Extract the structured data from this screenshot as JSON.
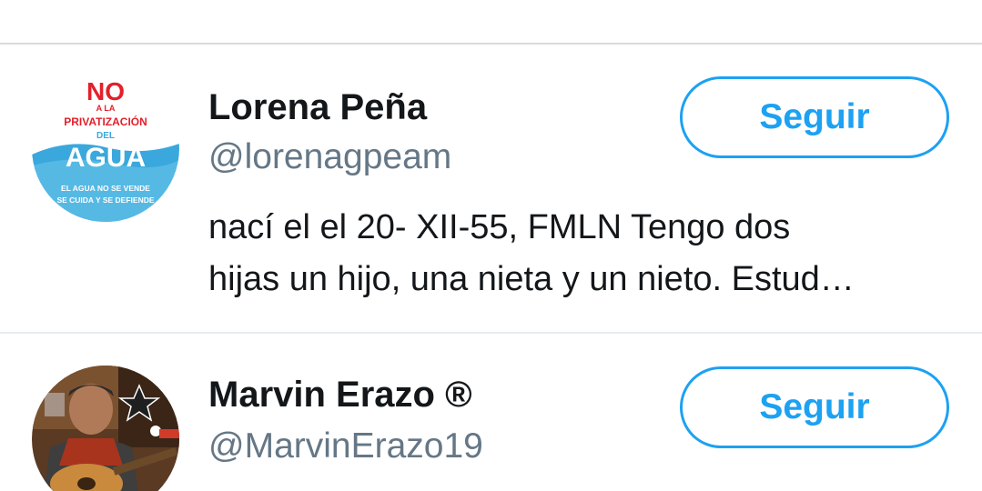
{
  "users": [
    {
      "name": "Lorena Peña",
      "handle": "@lorenagpeam",
      "follow_label": "Seguir",
      "bio_lines": [
        "nací el el 20- XII-55, FMLN Tengo dos",
        "hijas un hijo, una nieta y un nieto. Estud…"
      ],
      "avatar": {
        "kind": "campaign-logo",
        "text_no": "NO",
        "text_a_la": "A LA",
        "text_privatizacion": "PRIVATIZACIÓN",
        "text_del": "DEL",
        "text_agua": "AGUA",
        "text_slogan_1": "EL AGUA NO SE VENDE",
        "text_slogan_2": "SE CUIDA Y SE DEFIENDE"
      }
    },
    {
      "name": "Marvin Erazo ®",
      "handle": "@MarvinErazo19",
      "follow_label": "Seguir",
      "avatar": {
        "kind": "photo-guitarist"
      }
    }
  ],
  "colors": {
    "accent": "#1da1f2",
    "name_text": "#14171a",
    "handle_text": "#657786",
    "divider": "#e6ecf0",
    "logo_red": "#e3202b",
    "logo_blue": "#3aa8dc"
  }
}
